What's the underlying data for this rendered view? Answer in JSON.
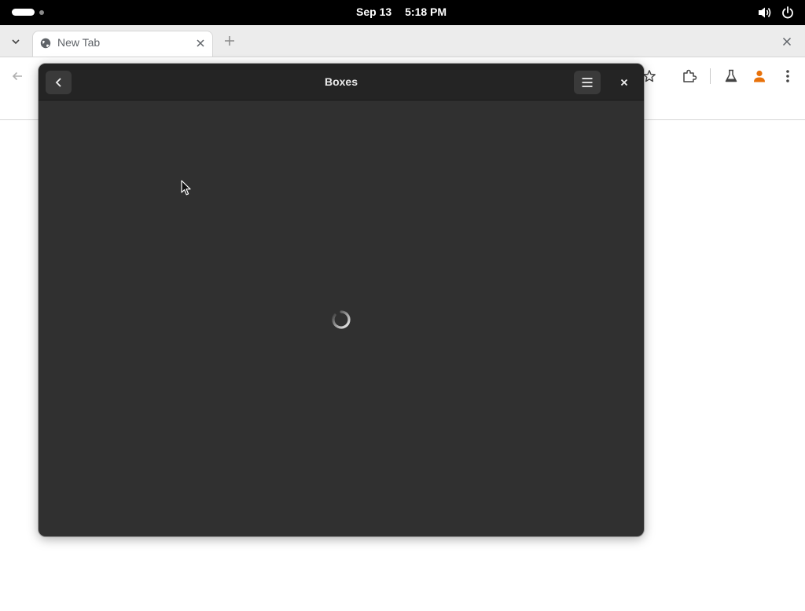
{
  "topbar": {
    "date": "Sep 13",
    "time": "5:18 PM",
    "icons": [
      "activities-indicator",
      "volume-icon",
      "power-icon"
    ]
  },
  "browser": {
    "tab": {
      "title": "New Tab",
      "favicon": "globe-icon"
    },
    "toolbar_icons": [
      "back-arrow-icon",
      "bookmark-star-icon",
      "extensions-icon",
      "labs-flask-icon",
      "profile-icon",
      "kebab-menu-icon"
    ],
    "colors": {
      "profile_accent": "#e8710a"
    }
  },
  "dialog": {
    "title": "Boxes",
    "state": "loading",
    "icons": [
      "back-chevron-icon",
      "hamburger-menu-icon",
      "close-icon",
      "loading-spinner"
    ],
    "colors": {
      "header_bg": "#242424",
      "body_bg": "#303030"
    }
  }
}
